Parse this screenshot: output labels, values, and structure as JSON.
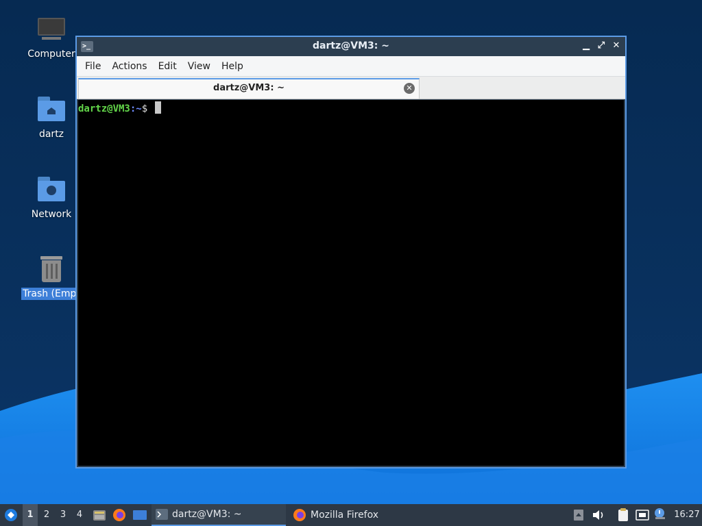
{
  "desktop": {
    "icons": [
      {
        "label": "Computer"
      },
      {
        "label": "dartz"
      },
      {
        "label": "Network"
      },
      {
        "label": "Trash (Empt"
      }
    ]
  },
  "terminal": {
    "title": "dartz@VM3: ~",
    "menu": [
      "File",
      "Actions",
      "Edit",
      "View",
      "Help"
    ],
    "tab_title": "dartz@VM3: ~",
    "prompt_user": "dartz@VM3",
    "prompt_colon": ":",
    "prompt_path": "~",
    "prompt_symbol": "$"
  },
  "taskbar": {
    "workspaces": [
      "1",
      "2",
      "3",
      "4"
    ],
    "active_workspace": "1",
    "tasks": [
      {
        "label": "dartz@VM3: ~",
        "icon": "terminal-icon",
        "active": true
      },
      {
        "label": "Mozilla Firefox",
        "icon": "firefox-icon",
        "active": false
      }
    ],
    "clock": "16:27"
  },
  "colors": {
    "accent": "#5b9be6",
    "prompt_user": "#63d64a",
    "prompt_path": "#6e8cff",
    "taskbar_bg": "#2d3845"
  }
}
